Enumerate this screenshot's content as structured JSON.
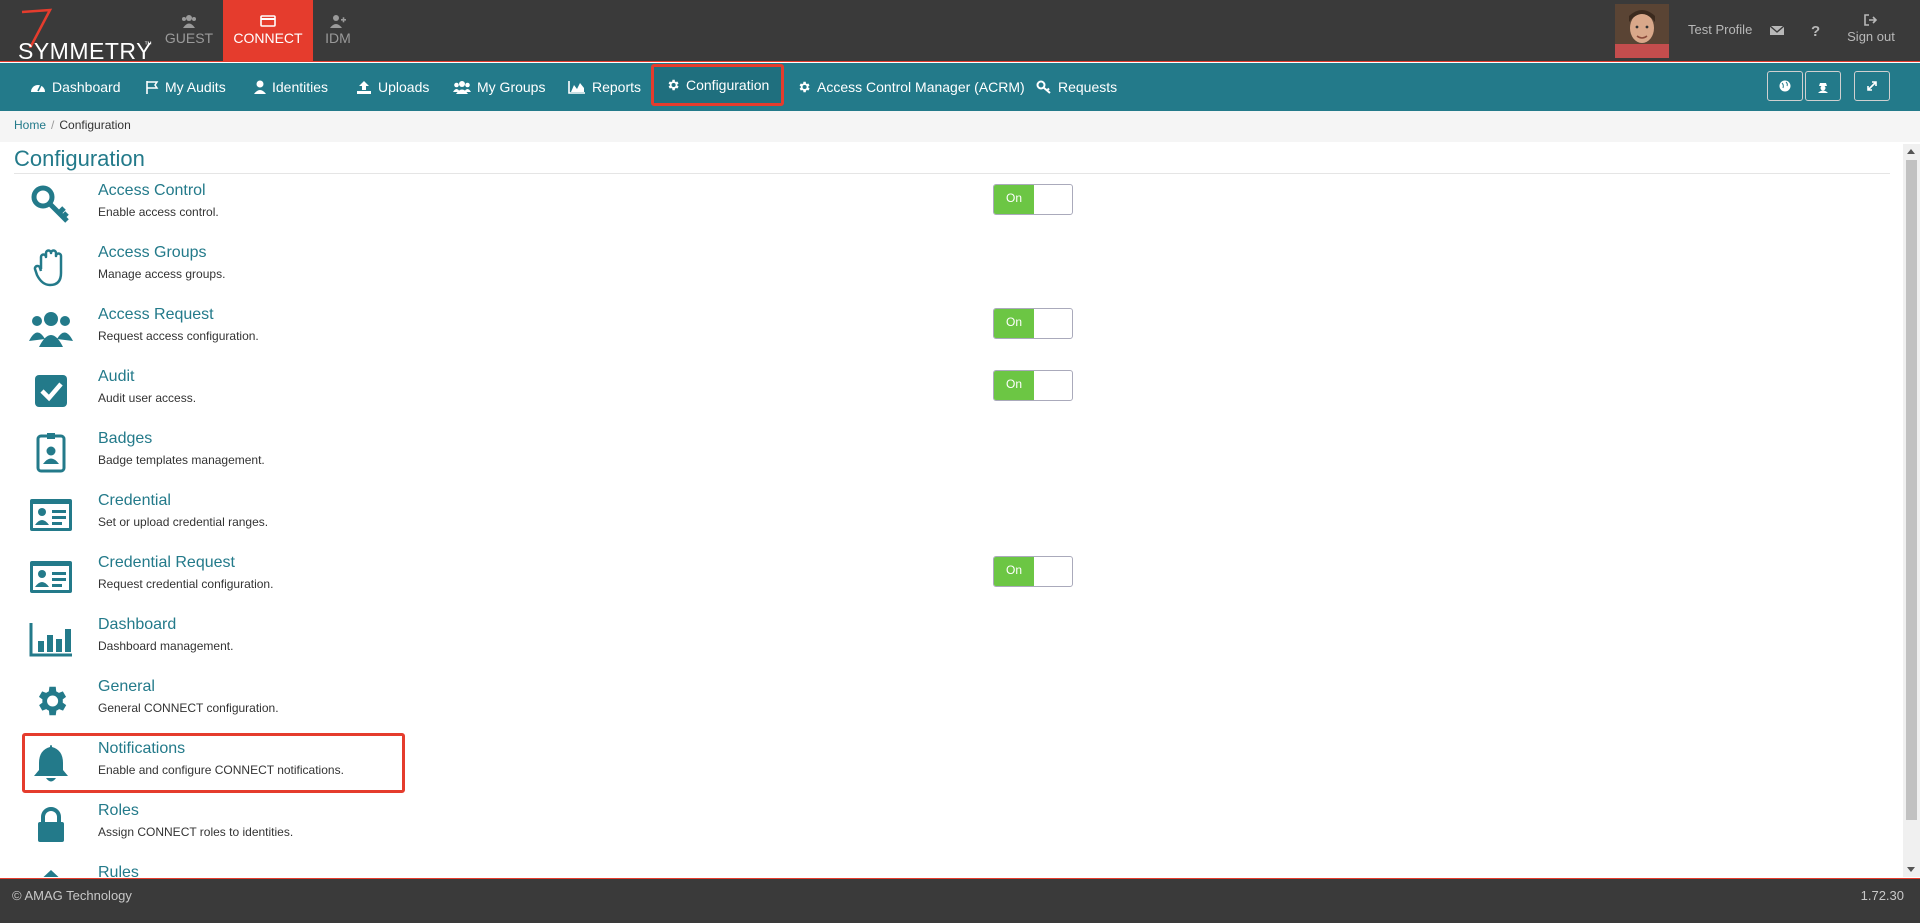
{
  "brand": {
    "name": "SYMMETRY",
    "tm": "™"
  },
  "app_tabs": [
    {
      "label": "GUEST",
      "icon": "users-icon"
    },
    {
      "label": "CONNECT",
      "icon": "id-card-icon",
      "active": true
    },
    {
      "label": "IDM",
      "icon": "user-plus-icon"
    }
  ],
  "profile": {
    "name": "Test Profile",
    "signout": "Sign out"
  },
  "nav": {
    "items": [
      {
        "label": "Dashboard",
        "icon": "dashboard-icon"
      },
      {
        "label": "My Audits",
        "icon": "flag-icon"
      },
      {
        "label": "Identities",
        "icon": "user-icon"
      },
      {
        "label": "Uploads",
        "icon": "upload-icon"
      },
      {
        "label": "My Groups",
        "icon": "group-icon"
      },
      {
        "label": "Reports",
        "icon": "area-chart-icon"
      },
      {
        "label": "Configuration",
        "icon": "gear-icon",
        "active": true
      },
      {
        "label": "Access Control Manager (ACRM)",
        "icon": "gear-icon"
      },
      {
        "label": "Requests",
        "icon": "key-icon"
      }
    ]
  },
  "breadcrumb": {
    "home": "Home",
    "separator": "/",
    "current": "Configuration"
  },
  "page": {
    "title": "Configuration"
  },
  "toggle_label": "On",
  "config_items": [
    {
      "name": "Access Control",
      "desc": "Enable access control.",
      "icon": "key-icon",
      "toggle": true
    },
    {
      "name": "Access Groups",
      "desc": "Manage access groups.",
      "icon": "hand-icon",
      "toggle": false
    },
    {
      "name": "Access Request",
      "desc": "Request access configuration.",
      "icon": "users-icon",
      "toggle": true
    },
    {
      "name": "Audit",
      "desc": "Audit user access.",
      "icon": "checkbox-icon",
      "toggle": true
    },
    {
      "name": "Badges",
      "desc": "Badge templates management.",
      "icon": "badge-icon",
      "toggle": false
    },
    {
      "name": "Credential",
      "desc": "Set or upload credential ranges.",
      "icon": "id-card-icon",
      "toggle": false
    },
    {
      "name": "Credential Request",
      "desc": "Request credential configuration.",
      "icon": "id-card-icon",
      "toggle": true
    },
    {
      "name": "Dashboard",
      "desc": "Dashboard management.",
      "icon": "bar-chart-icon",
      "toggle": false
    },
    {
      "name": "General",
      "desc": "General CONNECT configuration.",
      "icon": "gear-icon",
      "toggle": false
    },
    {
      "name": "Notifications",
      "desc": "Enable and configure CONNECT notifications.",
      "icon": "bell-icon",
      "toggle": false
    },
    {
      "name": "Roles",
      "desc": "Assign CONNECT roles to identities.",
      "icon": "lock-icon",
      "toggle": false
    },
    {
      "name": "Rules",
      "desc": "",
      "icon": "rules-icon",
      "toggle": false
    }
  ],
  "footer": {
    "copyright": "© AMAG Technology",
    "version": "1.72.30"
  },
  "colors": {
    "teal": "#237a8a",
    "red": "#e53c2d",
    "dark": "#3a3a3a",
    "green": "#6cc644"
  }
}
